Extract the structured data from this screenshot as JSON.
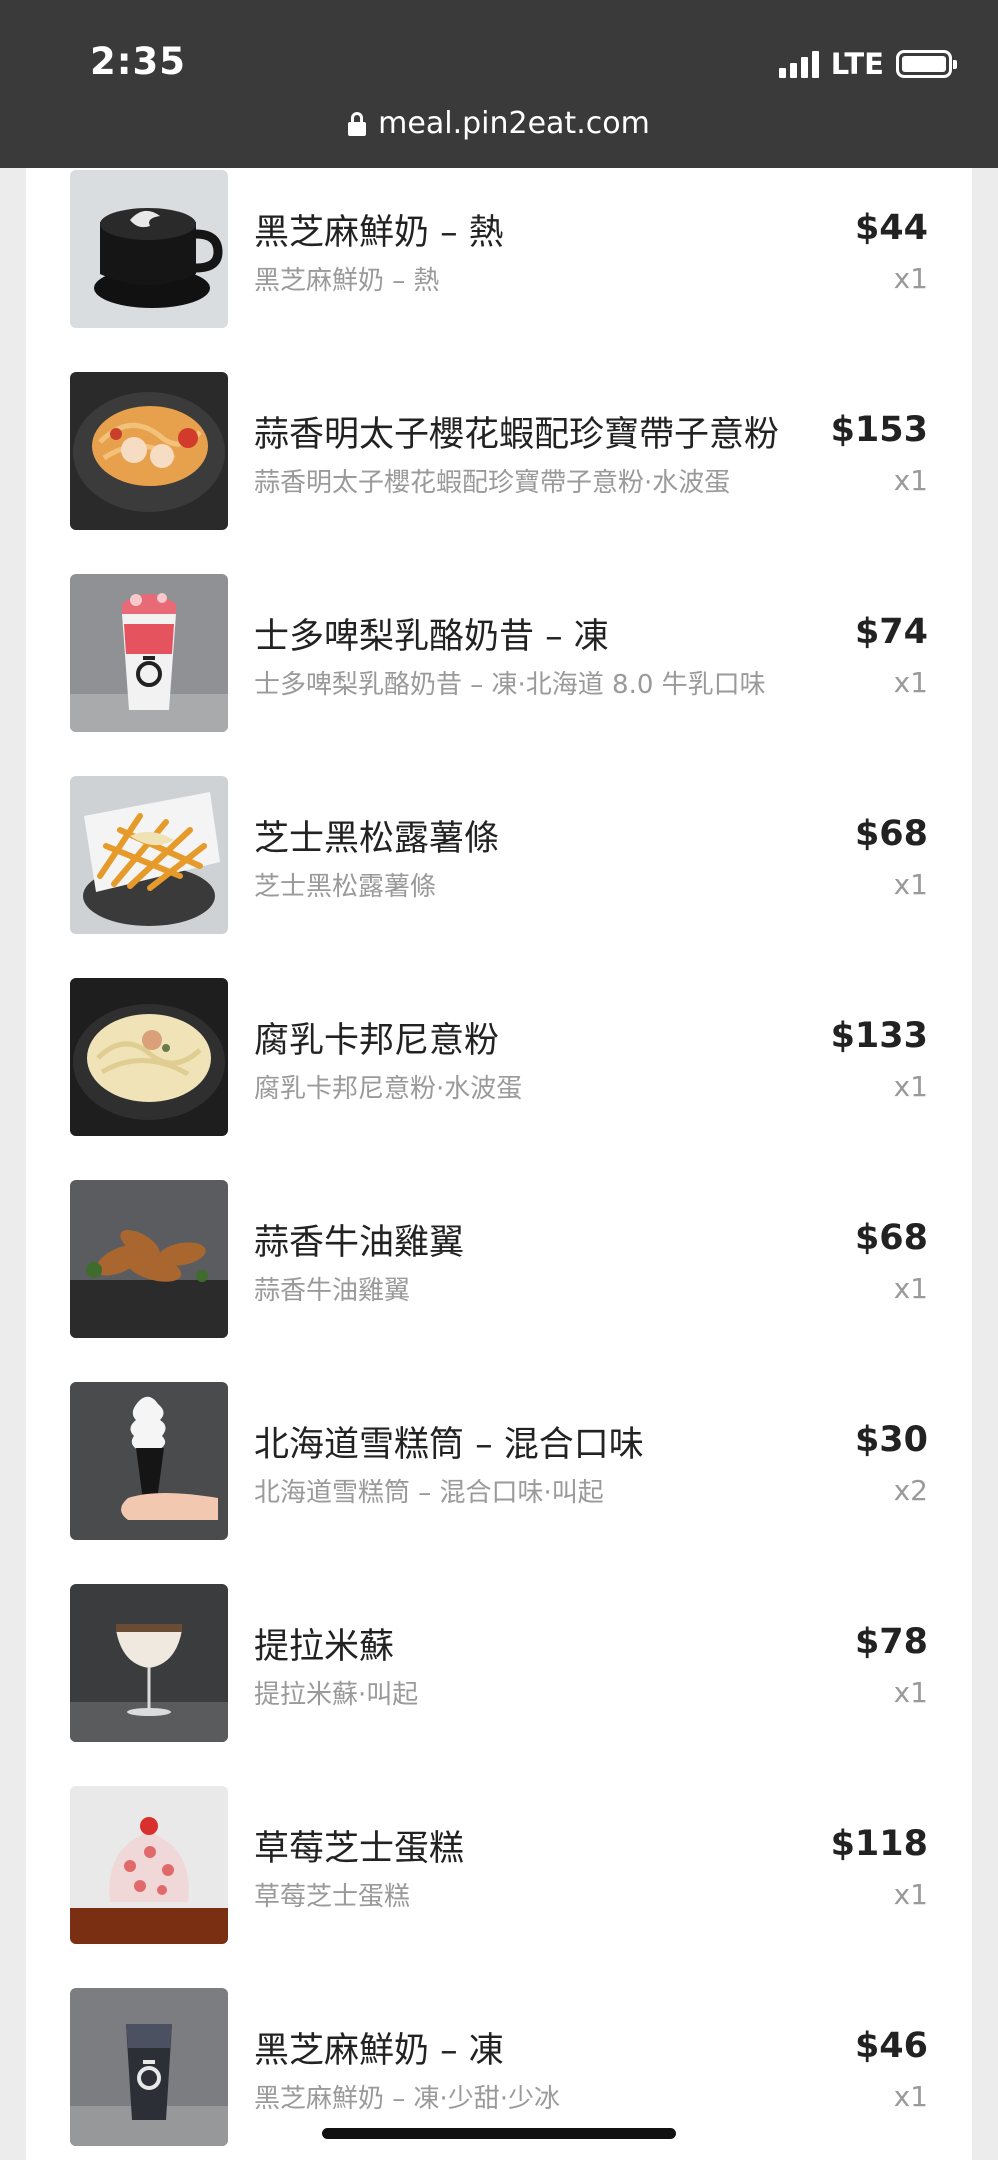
{
  "status": {
    "time": "2:35",
    "network": "LTE"
  },
  "browser": {
    "url": "meal.pin2eat.com"
  },
  "order_items": [
    {
      "name": "黑芝麻鮮奶 – 熱",
      "detail": "黑芝麻鮮奶 – 熱",
      "price": "$44",
      "qty": "x1"
    },
    {
      "name": "蒜香明太子櫻花蝦配珍寶帶子意粉",
      "detail": "蒜香明太子櫻花蝦配珍寶帶子意粉·水波蛋",
      "price": "$153",
      "qty": "x1"
    },
    {
      "name": "士多啤梨乳酪奶昔 – 凍",
      "detail": "士多啤梨乳酪奶昔 – 凍·北海道 8.0 牛乳口味",
      "price": "$74",
      "qty": "x1"
    },
    {
      "name": "芝士黑松露薯條",
      "detail": "芝士黑松露薯條",
      "price": "$68",
      "qty": "x1"
    },
    {
      "name": "腐乳卡邦尼意粉",
      "detail": "腐乳卡邦尼意粉·水波蛋",
      "price": "$133",
      "qty": "x1"
    },
    {
      "name": "蒜香牛油雞翼",
      "detail": "蒜香牛油雞翼",
      "price": "$68",
      "qty": "x1"
    },
    {
      "name": "北海道雪糕筒 – 混合口味",
      "detail": "北海道雪糕筒 – 混合口味·叫起",
      "price": "$30",
      "qty": "x2"
    },
    {
      "name": "提拉米蘇",
      "detail": "提拉米蘇·叫起",
      "price": "$78",
      "qty": "x1"
    },
    {
      "name": "草莓芝士蛋糕",
      "detail": "草莓芝士蛋糕",
      "price": "$118",
      "qty": "x1"
    },
    {
      "name": "黑芝麻鮮奶 – 凍",
      "detail": "黑芝麻鮮奶 – 凍·少甜·少冰",
      "price": "$46",
      "qty": "x1"
    }
  ]
}
